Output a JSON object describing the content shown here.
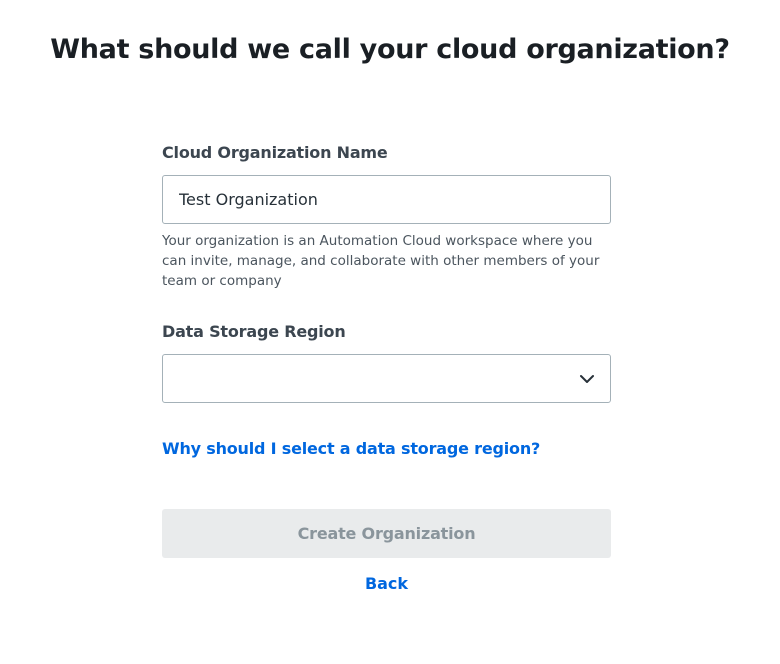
{
  "page": {
    "title": "What should we call your cloud organization?"
  },
  "form": {
    "org_name": {
      "label": "Cloud Organization Name",
      "value": "Test Organization",
      "helper": "Your organization is an Automation Cloud workspace where you can invite, manage, and collaborate with other members of your team or company"
    },
    "region": {
      "label": "Data Storage Region",
      "selected": "",
      "icon": "chevron-down-icon"
    },
    "help_link": "Why should I select a data storage region?",
    "create_button": "Create Organization",
    "back_link": "Back"
  },
  "colors": {
    "link": "#0067df",
    "button_disabled_bg": "#e9ebec",
    "button_disabled_text": "#8a959c",
    "input_border": "#a4b1b8"
  }
}
